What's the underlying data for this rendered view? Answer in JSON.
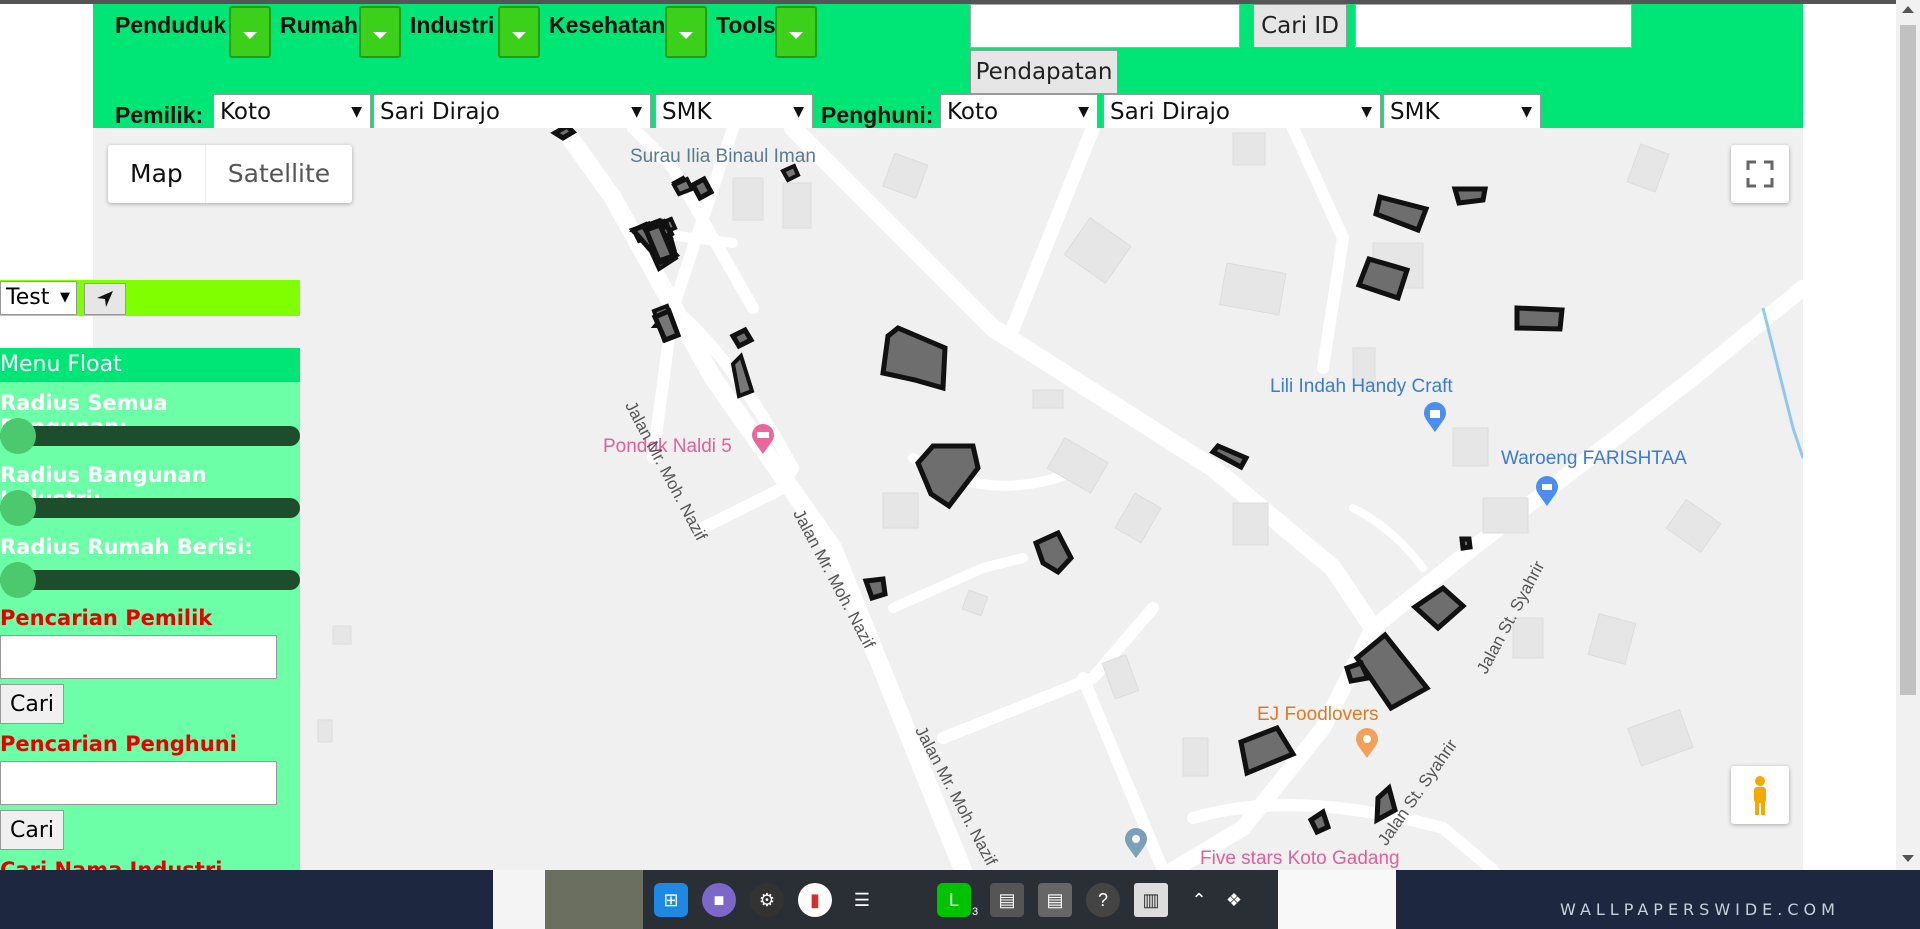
{
  "topbar": {
    "menus": [
      {
        "label": "Penduduk"
      },
      {
        "label": "Rumah"
      },
      {
        "label": "Industri"
      },
      {
        "label": "Kesehatan"
      },
      {
        "label": "Tools"
      }
    ],
    "cari_id_label": "Cari ID",
    "pendapatan_label": "Pendapatan",
    "pemilik_label": "Pemilik:",
    "penghuni_label": "Penghuni:",
    "pemilik_selects": [
      "Koto",
      "Sari Dirajo",
      "SMK"
    ],
    "penghuni_selects": [
      "Koto",
      "Sari Dirajo",
      "SMK"
    ]
  },
  "map": {
    "type_map": "Map",
    "type_satellite": "Satellite",
    "pois": {
      "surau": "Surau Ilia Binaul Iman",
      "pondok": "Pondok Naldi 5",
      "lili": "Lili Indah Handy Craft",
      "waroeng": "Waroeng FARISHTAA",
      "ej": "EJ Foodlovers",
      "fivestars": "Five stars Koto Gadang"
    },
    "roads": {
      "nazif1": "Jalan Mr. Moh. Nazif",
      "nazif2": "Jalan Mr. Moh. Nazif",
      "nazif3": "Jalan Mr. Moh. Nazif",
      "syahrir1": "Jalan St. Syahrir",
      "syahrir2": "Jalan St. Syahrir"
    }
  },
  "sidebar": {
    "test_select": "Test",
    "menu_float_title": "Menu Float",
    "slider_labels": {
      "semua": "Radius Semua Bangunan:",
      "industri": "Radius Bangunan Industri:",
      "rumah": "Radius Rumah Berisi:"
    },
    "pencarian_pemilik": "Pencarian Pemilik",
    "pencarian_penghuni": "Pencarian Penghuni",
    "cari_label": "Cari",
    "cari_nama_industri": "Cari Nama Industri"
  },
  "taskbar": {
    "line_badge": "3",
    "wallpaper_text": "WALLPAPERSWIDE.COM"
  },
  "colors": {
    "panel_green": "#00e676",
    "menu_button_green": "#3bd11a",
    "float_bg": "#6dffa8",
    "alert_red": "#e60000",
    "lime": "#7fff00"
  }
}
